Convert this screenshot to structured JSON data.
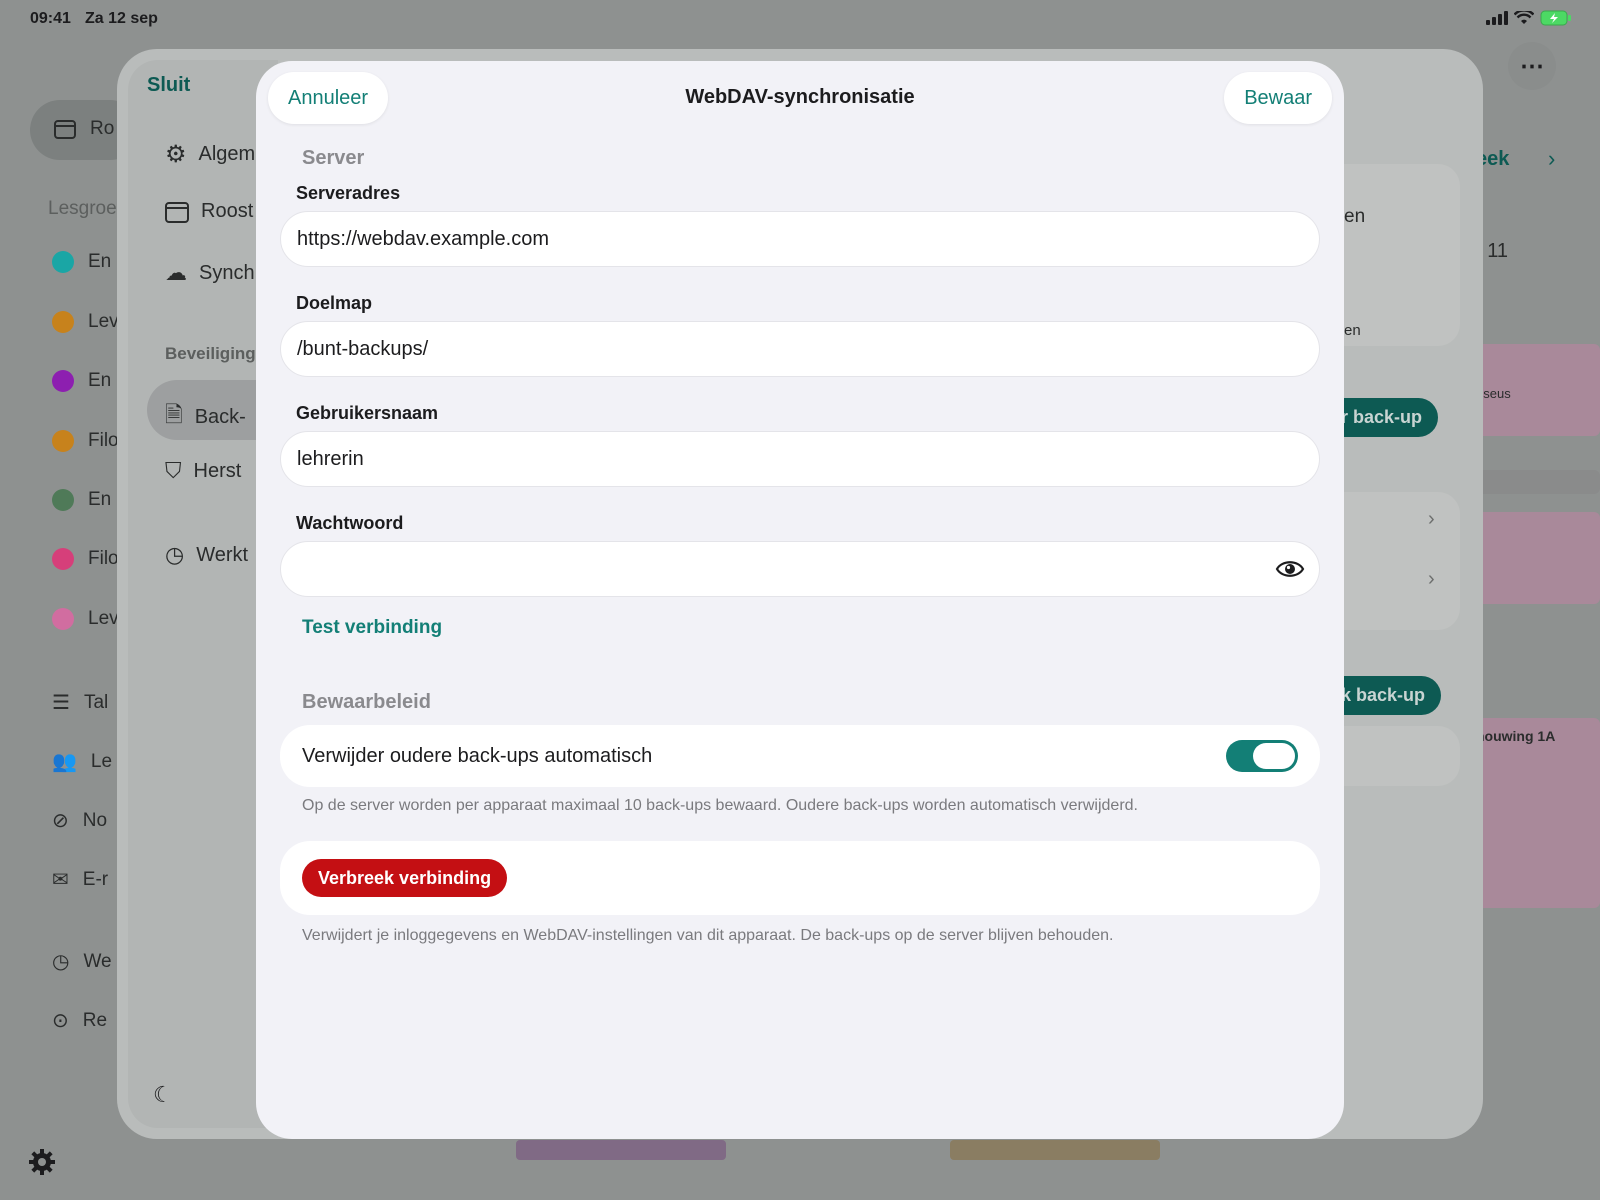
{
  "status_bar": {
    "time": "09:41",
    "date": "Za 12 sep",
    "icons": [
      "signal-icon",
      "wifi-icon",
      "battery-charging-icon"
    ]
  },
  "background_app": {
    "nav_top_label": "Ro",
    "section_label": "Lesgroe",
    "groups": [
      {
        "label": "En",
        "color": "#1aa6a5"
      },
      {
        "label": "Lev",
        "color": "#c7821c"
      },
      {
        "label": "En",
        "color": "#8d1fb0"
      },
      {
        "label": "Filo",
        "color": "#c7821c"
      },
      {
        "label": "En",
        "color": "#4f7a58"
      },
      {
        "label": "Filo",
        "color": "#d63f7a"
      },
      {
        "label": "Lev",
        "color": "#d16da0"
      }
    ],
    "tools": [
      {
        "label": "Tal",
        "icon": "list-icon"
      },
      {
        "label": "Le",
        "icon": "people-icon"
      },
      {
        "label": "No",
        "icon": "no-sign-icon"
      },
      {
        "label": "E-r",
        "icon": "mail-icon"
      },
      {
        "label": "We",
        "icon": "clock-icon"
      },
      {
        "label": "Re",
        "icon": "play-circle-icon"
      }
    ],
    "right_texts": {
      "week": "eek",
      "r1": "en",
      "r2": "r 11",
      "r3": "en",
      "teal1": "r back-up",
      "pink": "eseus",
      "teal2": "k back-up",
      "bouwing": "houwing 1A"
    }
  },
  "settings": {
    "close_label": "Sluit",
    "items": [
      {
        "label": "Algem",
        "icon": "gear-icon"
      },
      {
        "label": "Roost",
        "icon": "calendar-icon"
      },
      {
        "label": "Synch",
        "icon": "cloud-lock-icon"
      }
    ],
    "security_section": "Beveiliging",
    "security_items": [
      {
        "label": "Back-",
        "icon": "document-lock-icon"
      },
      {
        "label": "Herst",
        "icon": "shield-key-icon"
      },
      {
        "label": "Werkt",
        "icon": "clock-icon"
      }
    ]
  },
  "modal": {
    "title": "WebDAV-synchronisatie",
    "cancel_label": "Annuleer",
    "save_label": "Bewaar",
    "server_section": "Server",
    "fields": {
      "server_label": "Serveradres",
      "server_value": "https://webdav.example.com",
      "folder_label": "Doelmap",
      "folder_value": "/bunt-backups/",
      "username_label": "Gebruikersnaam",
      "username_value": "lehrerin",
      "password_label": "Wachtwoord",
      "password_value": ""
    },
    "test_connection": "Test verbinding",
    "retention_section": "Bewaarbeleid",
    "auto_delete_label": "Verwijder oudere back-ups automatisch",
    "auto_delete_on": true,
    "retention_note": "Op de server worden per apparaat maximaal 10 back-ups bewaard. Oudere back-ups worden automatisch verwijderd.",
    "disconnect_label": "Verbreek verbinding",
    "disconnect_note": "Verwijdert je inloggegevens en WebDAV-instellingen van dit apparaat. De back-ups op de server blijven behouden.",
    "colors": {
      "accent": "#137f76",
      "danger": "#c40f13",
      "background": "#f2f2f7"
    }
  }
}
